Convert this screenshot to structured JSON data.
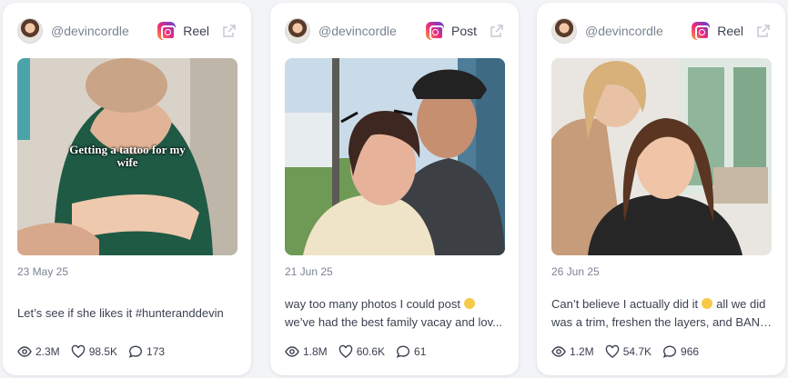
{
  "cards": [
    {
      "handle": "@devincordle",
      "type": "Reel",
      "overlay": "Getting a tattoo for my wife",
      "date": "23 May 25",
      "caption": [
        "Let’s see if she likes it #hunteranddevin"
      ],
      "stats": {
        "views": "2.3M",
        "likes": "98.5K",
        "comments": "173"
      }
    },
    {
      "handle": "@devincordle",
      "type": "Post",
      "overlay": "",
      "date": "21 Jun 25",
      "caption": [
        "way too many photos I could post",
        "we’ve had the best family vacay and lov..."
      ],
      "stats": {
        "views": "1.8M",
        "likes": "60.6K",
        "comments": "61"
      }
    },
    {
      "handle": "@devincordle",
      "type": "Reel",
      "overlay": "",
      "date": "26 Jun 25",
      "caption": [
        "Can’t believe I actually did it",
        "all we did",
        "was a trim, freshen the layers, and BANG..."
      ],
      "stats": {
        "views": "1.2M",
        "likes": "54.7K",
        "comments": "966"
      }
    }
  ],
  "icons": {
    "platform": "instagram-icon",
    "external": "external-link-icon",
    "views": "eye-icon",
    "likes": "heart-icon",
    "comments": "comment-icon"
  }
}
